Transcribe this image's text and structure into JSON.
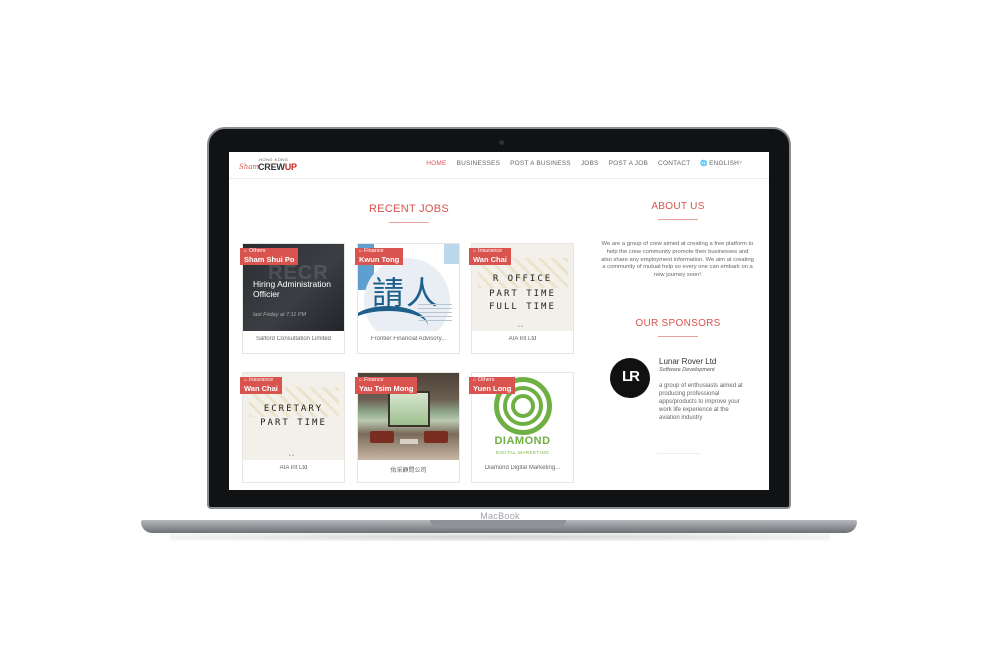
{
  "laptop": {
    "brand_label": "MacBook"
  },
  "header": {
    "logo_top": "HONG KONG",
    "logo_swirl": "Sham",
    "logo_main": "CREW",
    "logo_accent": "UP",
    "nav": [
      "HOME",
      "BUSINESSES",
      "POST A BUSINESS",
      "JOBS",
      "POST A JOB",
      "CONTACT",
      "ENGLISH"
    ],
    "chevron": "˅"
  },
  "recent_jobs": {
    "title": "RECENT JOBS",
    "cards": [
      {
        "category": "Others",
        "location": "Sham Shui Po",
        "image_title": "Hiring Administration Officier",
        "image_date": "last Friday at 7:11 PM",
        "company": "Salford Consultation Limited"
      },
      {
        "category": "Finance",
        "location": "Kwun Tong",
        "image_glyph": "請人",
        "company": "Frontier Financial Advisory..."
      },
      {
        "category": "Insurance",
        "location": "Wan Chai",
        "image_lines": [
          "R OFFICE",
          "PART TIME",
          "FULL TIME"
        ],
        "company": "AIA Int Ltd"
      },
      {
        "category": "Insurance",
        "location": "Wan Chai",
        "image_lines": [
          "ECRETARY",
          "PART TIME"
        ],
        "company": "AIA Int Ltd"
      },
      {
        "category": "Finance",
        "location": "Yau Tsim Mong",
        "company": "佑采顧問公司"
      },
      {
        "category": "Others",
        "location": "Yuen Long",
        "image_word": "DIAMOND",
        "image_sub": "DIGITAL MARKETING",
        "company": "Diamond Digital Marketing..."
      }
    ]
  },
  "about": {
    "title": "ABOUT US",
    "text": "We are a group of crew aimed at creating a free platform to help the crew community promote their businesses and also share any employment information. We aim at creating a community of mutual help so every one can embark on a new journey soon!"
  },
  "sponsors": {
    "title": "OUR SPONSORS",
    "items": [
      {
        "logo": "LR",
        "name": "Lunar Rover Ltd",
        "type": "Software Development",
        "desc": "a group of enthusiasts aimed at producing professional apps/products to improve your work life experience at the aviation industry"
      }
    ]
  },
  "colors": {
    "accent": "#d9534f",
    "diamond_green": "#6fb044",
    "dark_blue": "#1f5f8b"
  }
}
